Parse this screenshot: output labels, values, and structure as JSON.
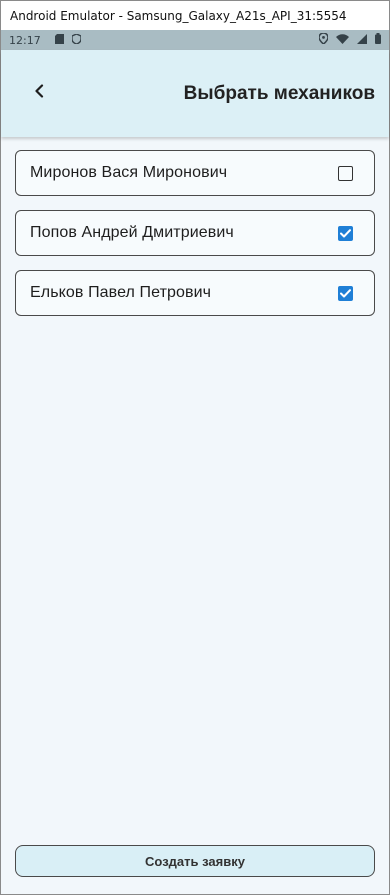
{
  "window": {
    "title": "Android Emulator - Samsung_Galaxy_A21s_API_31:5554"
  },
  "statusbar": {
    "time": "12:17",
    "left_icons": [
      "sd-card-icon",
      "shield-icon"
    ],
    "right_icons": [
      "location-icon",
      "wifi-icon",
      "signal-icon",
      "battery-icon"
    ]
  },
  "appbar": {
    "back_icon": "chevron-left-icon",
    "title": "Выбрать механиков"
  },
  "mechanics": [
    {
      "name": "Миронов Вася Миронович",
      "checked": false
    },
    {
      "name": "Попов Андрей Дмитриевич",
      "checked": true
    },
    {
      "name": "Ельков Павел Петрович",
      "checked": true
    }
  ],
  "footer": {
    "create_button_label": "Создать заявку"
  },
  "colors": {
    "appbar_bg": "#dcf0f6",
    "statusbar_bg": "#a9bcc3",
    "checkbox_checked": "#1f7fd6",
    "page_bg": "#f2f7fb"
  }
}
